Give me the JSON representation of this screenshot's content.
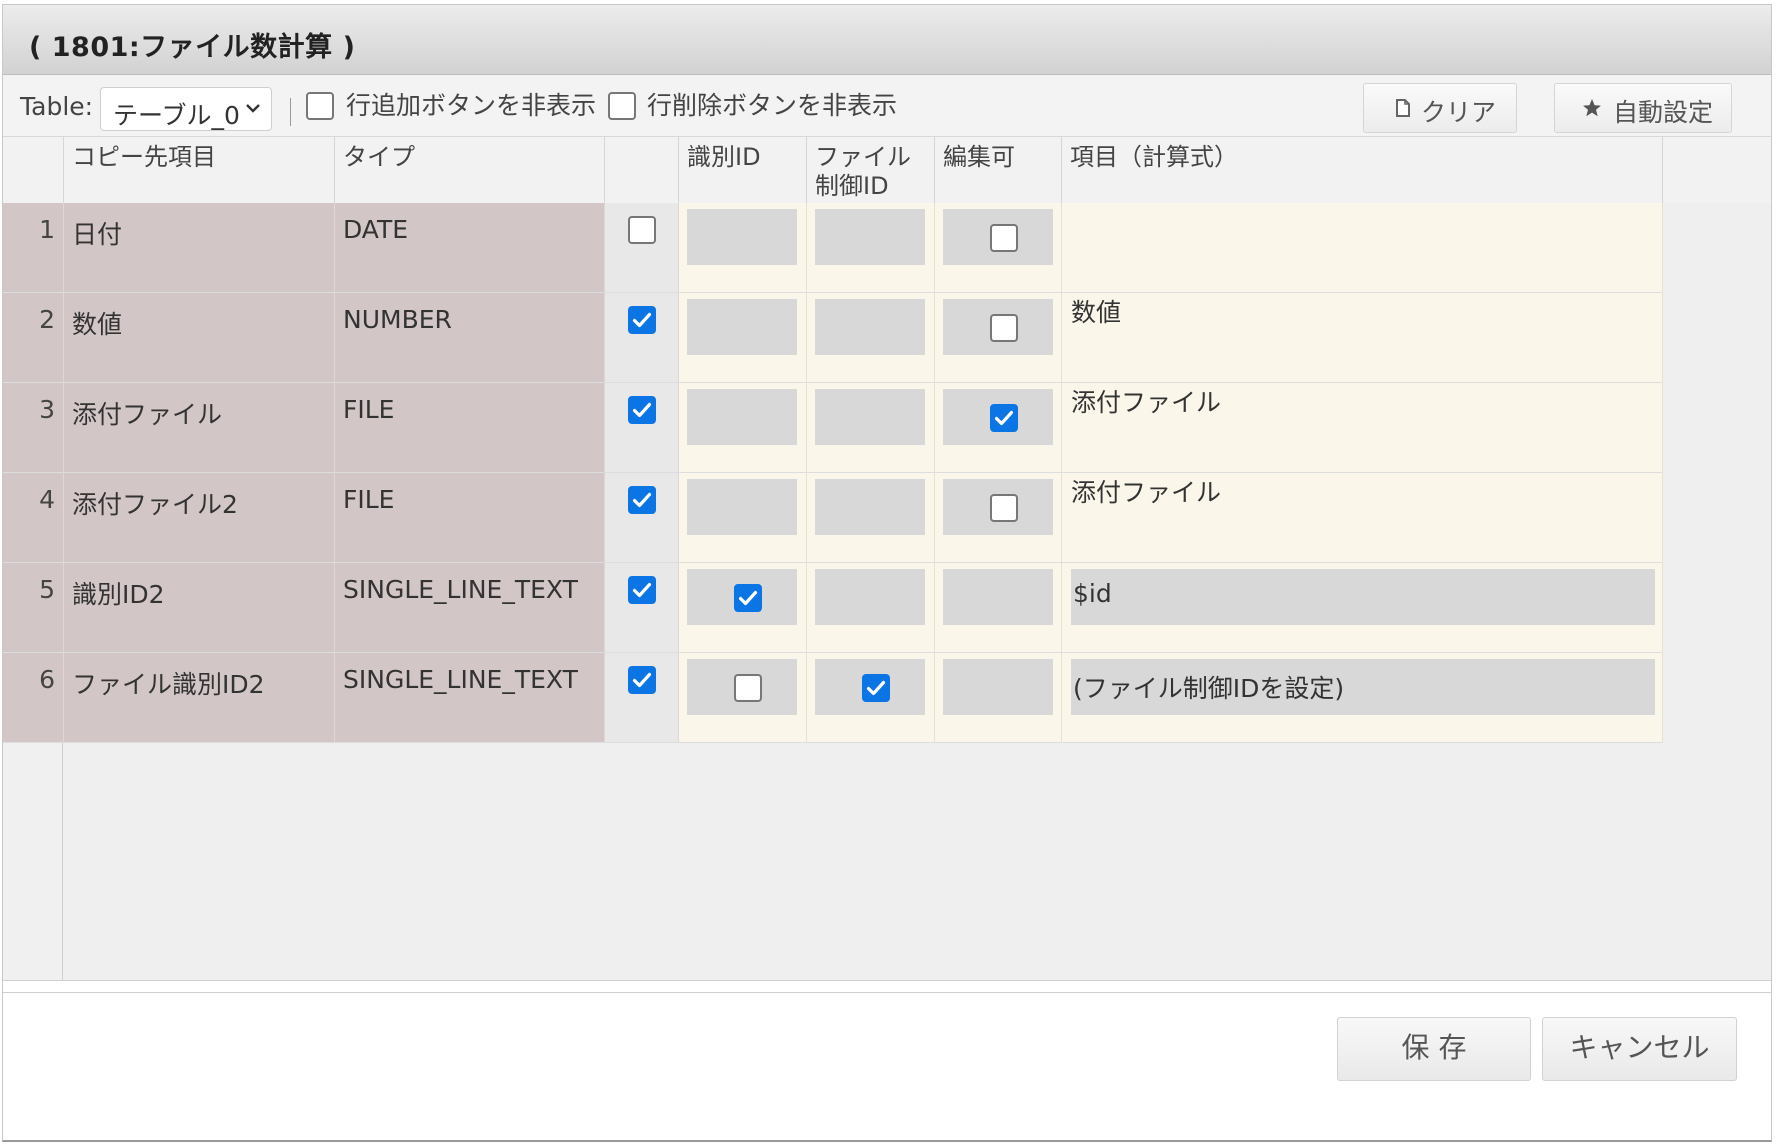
{
  "dialog": {
    "title": "( 1801:ファイル数計算 )"
  },
  "toolbar": {
    "table_label": "Table:",
    "table_select_value": "テーブル_0",
    "hide_add_row_label": "行追加ボタンを非表示",
    "hide_add_row_checked": false,
    "hide_delete_row_label": "行削除ボタンを非表示",
    "hide_delete_row_checked": false,
    "clear_label": "クリア",
    "auto_setting_label": "自動設定"
  },
  "columns": {
    "dest_item": "コピー先項目",
    "type": "タイプ",
    "use": "",
    "identifier_id": "識別ID",
    "file_control_id": "ファイル\n制御ID",
    "editable": "編集可",
    "item_formula": "項目（計算式）"
  },
  "rows": [
    {
      "num": "1",
      "dest_item": "日付",
      "type": "DATE",
      "use": false,
      "identifier_id": null,
      "file_control_id": null,
      "editable": false,
      "item_formula": "",
      "formula_readonly": false
    },
    {
      "num": "2",
      "dest_item": "数値",
      "type": "NUMBER",
      "use": true,
      "identifier_id": null,
      "file_control_id": null,
      "editable": false,
      "item_formula": "数値",
      "formula_readonly": false
    },
    {
      "num": "3",
      "dest_item": "添付ファイル",
      "type": "FILE",
      "use": true,
      "identifier_id": null,
      "file_control_id": null,
      "editable": true,
      "item_formula": "添付ファイル",
      "formula_readonly": false
    },
    {
      "num": "4",
      "dest_item": "添付ファイル2",
      "type": "FILE",
      "use": true,
      "identifier_id": null,
      "file_control_id": null,
      "editable": false,
      "item_formula": "添付ファイル",
      "formula_readonly": false
    },
    {
      "num": "5",
      "dest_item": "識別ID2",
      "type": "SINGLE_LINE_TEXT",
      "use": true,
      "identifier_id": true,
      "file_control_id": null,
      "editable": null,
      "item_formula": "$id",
      "formula_readonly": true
    },
    {
      "num": "6",
      "dest_item": "ファイル識別ID2",
      "type": "SINGLE_LINE_TEXT",
      "use": true,
      "identifier_id": false,
      "file_control_id": true,
      "editable": null,
      "item_formula": "(ファイル制御IDを設定)",
      "formula_readonly": true
    }
  ],
  "footer": {
    "save_label": "保 存",
    "cancel_label": "キャンセル"
  },
  "colors": {
    "accent": "#0b75e6",
    "readonly_cell": "#d3c6c6",
    "editable_cell": "#faf7ea"
  }
}
